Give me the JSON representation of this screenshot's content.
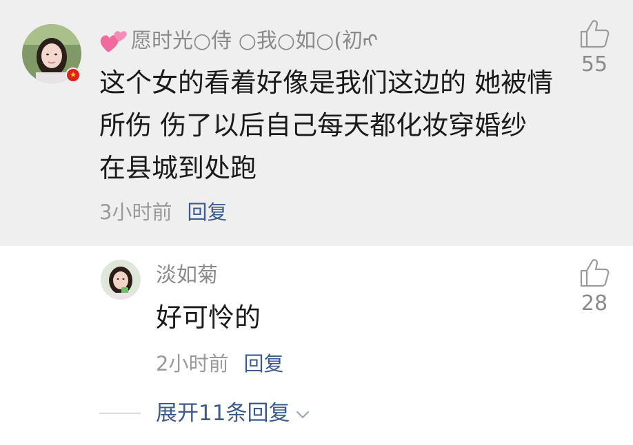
{
  "main_comment": {
    "username": "愿时光○侍 ○我○如○(初ᡢ",
    "text": "这个女的看着好像是我们这边的 她被情所伤 伤了以后自己每天都化妆穿婚纱 在县城到处跑",
    "time": "3小时前",
    "reply_label": "回复",
    "likes": "55",
    "badge_icon": "china-flag-icon",
    "username_prefix_icon": "pink-hearts-icon"
  },
  "reply_comment": {
    "username": "淡如菊",
    "text": "好可怜的",
    "time": "2小时前",
    "reply_label": "回复",
    "likes": "28"
  },
  "expand_label": "展开11条回复",
  "colors": {
    "main_background": "#efefef",
    "link": "#3b5b8c",
    "username": "#8a8a8a",
    "body_text": "#1a1a1a",
    "meta_time": "#9a9a9a"
  }
}
